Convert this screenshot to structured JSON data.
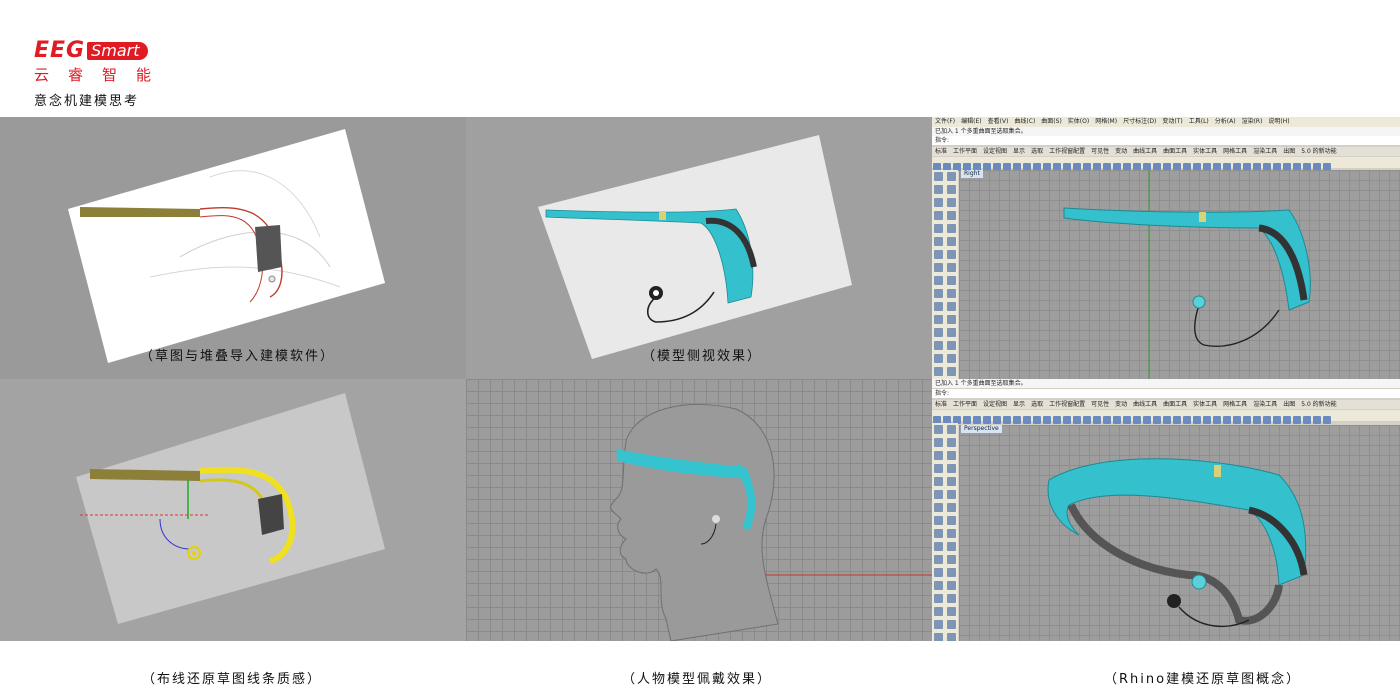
{
  "logo": {
    "eeg": "EEG",
    "smart": "Smart",
    "chinese": "云睿智能"
  },
  "subtitle": "意念机建模思考",
  "captions": {
    "sketch_import": "（草图与堆叠导入建模软件）",
    "side_view": "（模型侧视效果）",
    "wiring": "（布线还原草图线条质感）",
    "wearing": "（人物模型佩戴效果）",
    "rhino": "（Rhino建模还原草图概念）"
  },
  "rhino": {
    "menu": [
      "文件(F)",
      "编辑(E)",
      "查看(V)",
      "曲线(C)",
      "曲面(S)",
      "实体(O)",
      "网格(M)",
      "尺寸标注(D)",
      "变动(T)",
      "工具(L)",
      "分析(A)",
      "渲染(R)",
      "说明(H)"
    ],
    "command_history": "已加入 1 个多重曲面至选取集合。",
    "command_prompt": "指令:",
    "tabs": [
      "标准",
      "工作平面",
      "设定视图",
      "显示",
      "选取",
      "工作视窗配置",
      "可见性",
      "变动",
      "曲线工具",
      "曲面工具",
      "实体工具",
      "网格工具",
      "渲染工具",
      "出图",
      "5.0 的新功能"
    ],
    "viewport_top": "Right",
    "viewport_bottom": "Perspective"
  },
  "colors": {
    "brand_red": "#e01b24",
    "cyan": "#35c3cf",
    "grey_bg": "#a0a0a0"
  }
}
